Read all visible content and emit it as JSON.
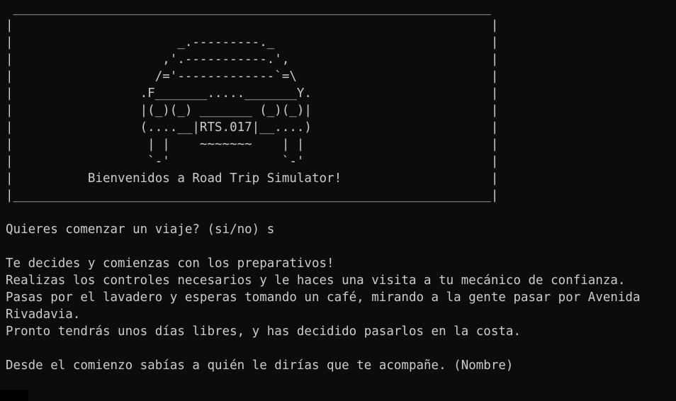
{
  "banner": {
    "lines": [
      " ________________________________________________________________",
      "|                                                                |",
      "|                      _.---------._                             |",
      "|                    ,'.-----------.',                           |",
      "|                   /='-------------`=\\                          |",
      "|                 .F_______....._______Y.                        |",
      "|                 |(_)(_) _______ (_)(_)|                        |",
      "|                 (....__|RTS.017|__....)                        |",
      "|                  | |    ~~~~~~~    | |                         |",
      "|                  `-'               `-'                         |",
      "|          Bienvenidos a Road Trip Simulator!                    |",
      "|________________________________________________________________|"
    ]
  },
  "console": {
    "prompt_start": "Quieres comenzar un viaje? (si/no) s",
    "narrative": [
      "Te decides y comienzas con los preparativos!",
      "Realizas los controles necesarios y le haces una visita a tu mecánico de confianza.",
      "Pasas por el lavadero y esperas tomando un café, mirando a la gente pasar por Avenida",
      "Rivadavia.",
      "Pronto tendrás unos días libres, y has decidido pasarlos en la costa."
    ],
    "prompt_name": "Desde el comienzo sabías a quién le dirías que te acompañe. (Nombre)"
  }
}
